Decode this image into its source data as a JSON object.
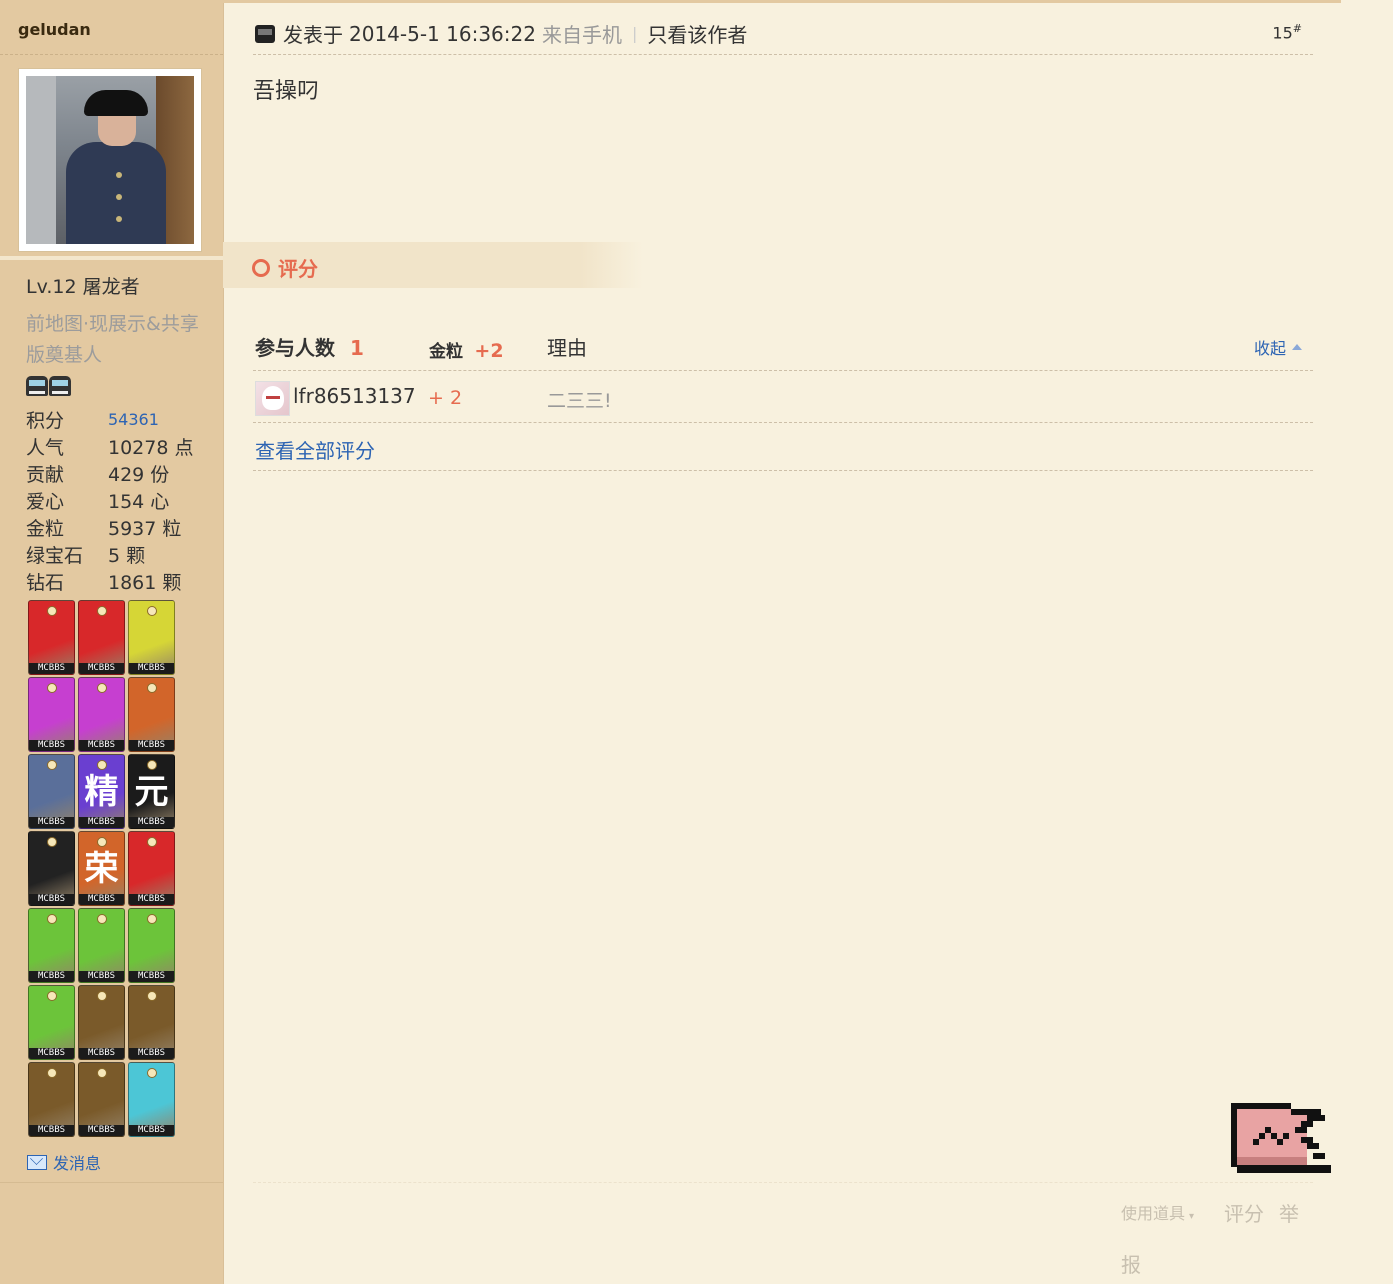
{
  "sidebar": {
    "username": "geludan",
    "level": "Lv.12 屠龙者",
    "title": "前地图·现展示&共享版奠基人",
    "stats": [
      {
        "label": "积分",
        "value": "54361"
      },
      {
        "label": "人气",
        "value": "10278 点"
      },
      {
        "label": "贡献",
        "value": "429 份"
      },
      {
        "label": "爱心",
        "value": "154 心"
      },
      {
        "label": "金粒",
        "value": "5937 粒"
      },
      {
        "label": "绿宝石",
        "value": "5 颗"
      },
      {
        "label": "钻石",
        "value": "1861 颗"
      }
    ],
    "medals": [
      {
        "glyph": "",
        "color": "#d8282a",
        "icon": "apple-medal-icon",
        "tag": "MCBBS"
      },
      {
        "glyph": "",
        "color": "#d8282a",
        "icon": "windows-medal-icon",
        "tag": "MCBBS"
      },
      {
        "glyph": "",
        "color": "#d6d636",
        "icon": "pickaxe-medal-icon",
        "tag": "MCBBS"
      },
      {
        "glyph": "",
        "color": "#c63fd0",
        "icon": "portrait-medal-icon",
        "tag": "MCBBS"
      },
      {
        "glyph": "",
        "color": "#c63fd0",
        "icon": "apple-red-medal-icon",
        "tag": "MCBBS"
      },
      {
        "glyph": "",
        "color": "#d2652a",
        "icon": "heart-medal-icon",
        "tag": "MCBBS"
      },
      {
        "glyph": "",
        "color": "#5a6f9a",
        "icon": "cake-medal-icon",
        "tag": "MCBBS"
      },
      {
        "glyph": "精",
        "color": "#6a3fd0",
        "icon": "jing-medal-icon",
        "tag": "MCBBS"
      },
      {
        "glyph": "元",
        "color": "#1b1b1b",
        "icon": "yuan-medal-icon",
        "tag": "MCBBS"
      },
      {
        "glyph": "",
        "color": "#222222",
        "icon": "ore-medal-icon",
        "tag": "MCBBS"
      },
      {
        "glyph": "荣",
        "color": "#d2652a",
        "icon": "rong-medal-icon",
        "tag": "MCBBS"
      },
      {
        "glyph": "",
        "color": "#d8282a",
        "icon": "logo-medal-icon",
        "tag": "MCBBS"
      },
      {
        "glyph": "",
        "color": "#6cc43a",
        "icon": "gold-ingot-medal-icon",
        "tag": "MCBBS"
      },
      {
        "glyph": "",
        "color": "#6cc43a",
        "icon": "sponge-medal-icon",
        "tag": "MCBBS"
      },
      {
        "glyph": "",
        "color": "#6cc43a",
        "icon": "news-sign-medal-icon",
        "tag": "MCBBS"
      },
      {
        "glyph": "",
        "color": "#6cc43a",
        "icon": "no-sign-medal-icon",
        "tag": "MCBBS"
      },
      {
        "glyph": "",
        "color": "#7a5a2a",
        "icon": "book-medal-icon",
        "tag": "MCBBS"
      },
      {
        "glyph": "",
        "color": "#7a5a2a",
        "icon": "furnace-medal-icon",
        "tag": "MCBBS"
      },
      {
        "glyph": "",
        "color": "#7a5a2a",
        "icon": "bed-medal-icon",
        "tag": "MCBBS"
      },
      {
        "glyph": "",
        "color": "#7a5a2a",
        "icon": "painting-medal-icon",
        "tag": "MCBBS"
      },
      {
        "glyph": "",
        "color": "#4cc6d6",
        "icon": "trophy-medal-icon",
        "tag": "MCBBS"
      }
    ],
    "send_message": "发消息"
  },
  "post": {
    "posted_prefix": "发表于",
    "datetime": "2014-5-1 16:36:22",
    "source": "来自手机",
    "only_author": "只看该作者",
    "floor": "15",
    "floor_mark": "#",
    "body": "吾操叼"
  },
  "rating": {
    "title": "评分",
    "participants_label": "参与人数",
    "participants_count": "1",
    "currency_label": "金粒",
    "currency_total": "+2",
    "reason_label": "理由",
    "collapse_label": "收起",
    "rows": [
      {
        "user": "lfr86513137",
        "score": "+ 2",
        "reason": "二三三!"
      }
    ],
    "view_all": "查看全部评分"
  },
  "actions": {
    "use_tool": "使用道具",
    "rate": "评分",
    "report_1": "举",
    "report_2": "报"
  },
  "colors": {
    "background": "#f8f1de",
    "sidebar": "#e3c9a1",
    "accent_red": "#e66b4f",
    "link_blue": "#2d64b3"
  }
}
